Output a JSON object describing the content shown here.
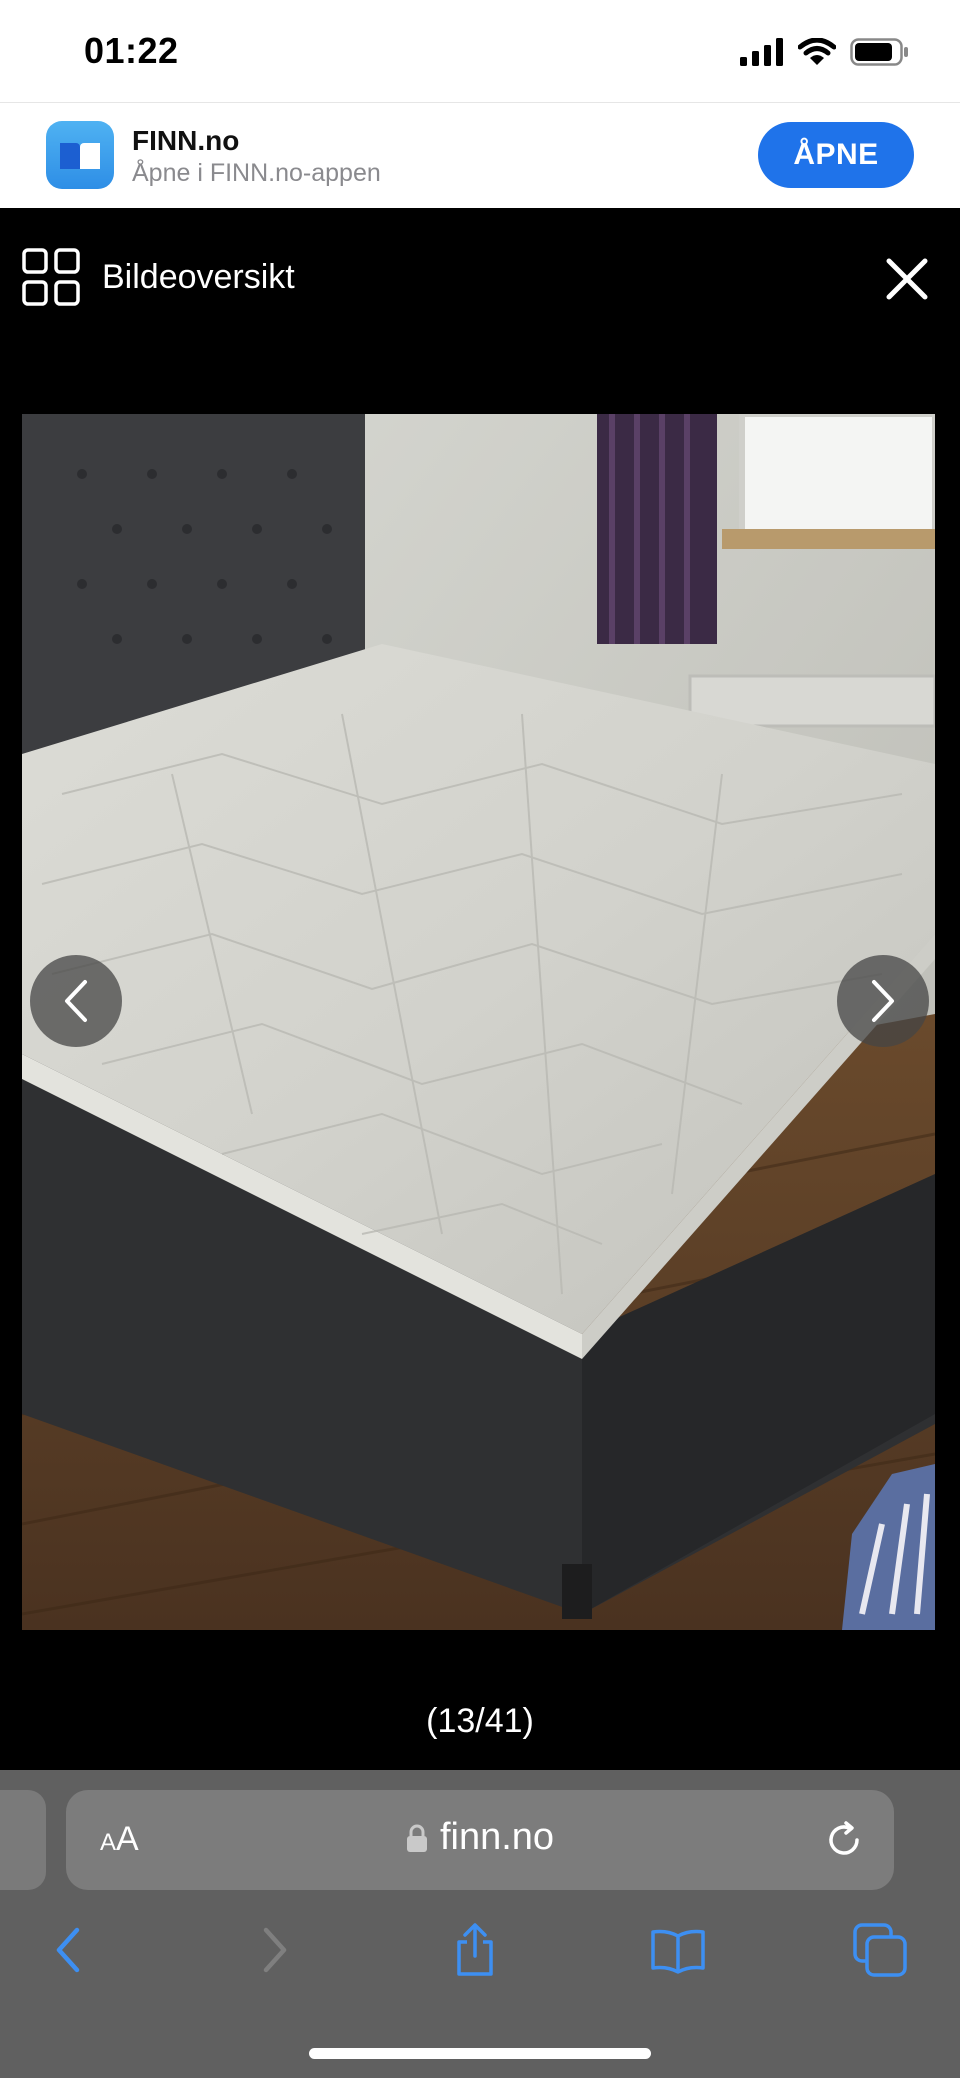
{
  "status_bar": {
    "time": "01:22",
    "icons": [
      "cellular-signal-icon",
      "wifi-icon",
      "battery-icon"
    ]
  },
  "app_banner": {
    "app_name": "FINN.no",
    "subtitle": "Åpne i FINN.no-appen",
    "open_label": "ÅPNE",
    "accent_color": "#1f73ea"
  },
  "gallery": {
    "overview_label": "Bildeoversikt",
    "counter": "(13/41)",
    "current_image": 13,
    "total_images": 41,
    "photo_description_icon": "bed-photo",
    "nav_icons": [
      "chevron-left-icon",
      "chevron-right-icon",
      "close-icon",
      "grid-icon"
    ]
  },
  "browser": {
    "text_size_label_small": "A",
    "text_size_label_large": "A",
    "url": "finn.no",
    "toolbar_icons": [
      "back-icon",
      "forward-icon",
      "share-icon",
      "bookmarks-icon",
      "tabs-icon"
    ],
    "toolbar_color": "#606060",
    "tint_color": "#3d8ff2"
  }
}
